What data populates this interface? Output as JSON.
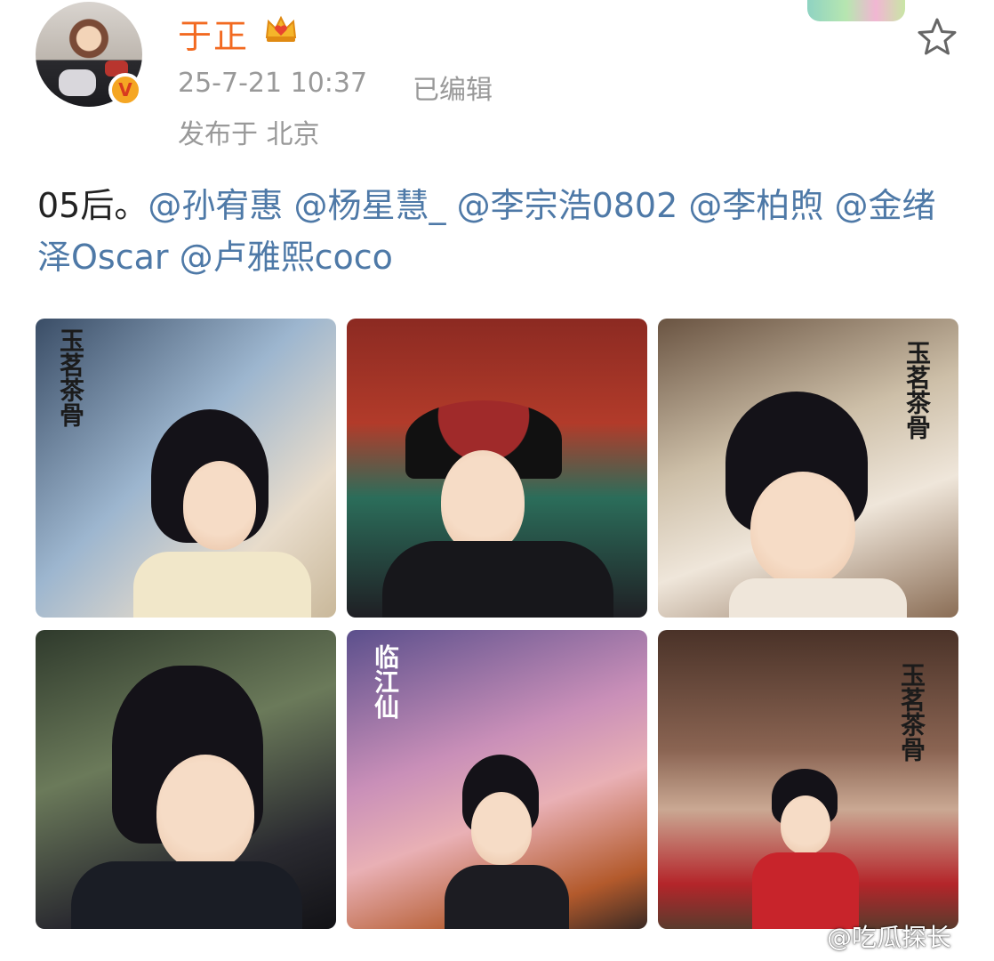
{
  "user": {
    "name": "于正",
    "verified_badge": "V",
    "crown_icon": "crown-icon"
  },
  "meta": {
    "time": "25-7-21 10:37",
    "edited": "已编辑",
    "location": "发布于 北京"
  },
  "post": {
    "prefix": "05后。",
    "mentions": [
      "@孙宥惠",
      "@杨星慧_",
      "@李宗浩0802",
      "@李柏煦",
      "@金绪泽Oscar",
      "@卢雅熙coco"
    ]
  },
  "photos": [
    {
      "title": "玉茗茶骨"
    },
    {
      "title": ""
    },
    {
      "title": "玉茗茶骨"
    },
    {
      "title": ""
    },
    {
      "title": "临江仙"
    },
    {
      "title": "玉茗茶骨"
    }
  ],
  "watermark": "@吃瓜探长",
  "colors": {
    "username": "#f26a21",
    "mention": "#4e79a7",
    "meta": "#999999"
  }
}
